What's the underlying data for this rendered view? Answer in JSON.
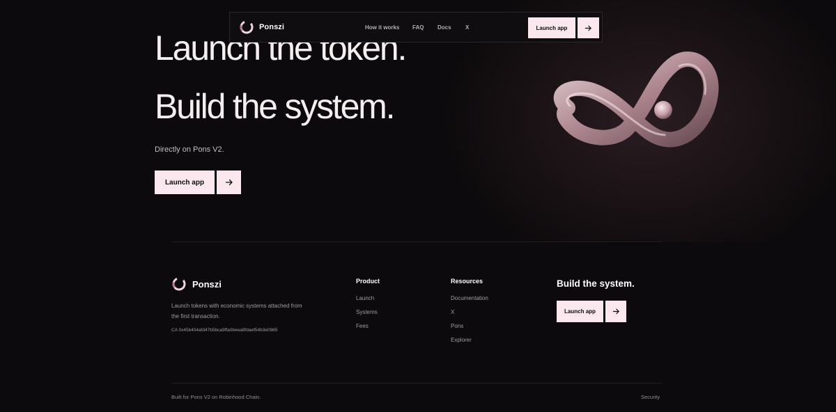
{
  "nav": {
    "brand": "Ponszi",
    "links": [
      "How it works",
      "FAQ",
      "Docs",
      "X"
    ],
    "launch_label": "Launch app"
  },
  "hero": {
    "line1": "Launch the token.",
    "line2": "Build the system.",
    "subtitle": "Directly on Pons V2.",
    "launch_label": "Launch app"
  },
  "footer": {
    "brand": "Ponszi",
    "description": "Launch tokens with economic systems attached from the first transaction.",
    "contract": "CA 0x45b404afd47b5bca9ffa0beea9fdaef54b3e0985",
    "product": {
      "heading": "Product",
      "links": [
        "Launch",
        "Systems",
        "Fees"
      ]
    },
    "resources": {
      "heading": "Resources",
      "links": [
        "Documentation",
        "X",
        "Pons",
        "Explorer"
      ]
    },
    "cta": {
      "title": "Build the system.",
      "launch_label": "Launch app"
    },
    "bottom": {
      "left": "Built for Pons V2 on Robinhood Chain.",
      "right": "Security"
    }
  },
  "icons": {
    "logo": "ponszi-ring-logo",
    "arrow": "arrow-right-icon",
    "hero_art": "glass-infinity-knot"
  },
  "colors": {
    "background": "#0c0a0c",
    "button": "#fbe8ee",
    "button_text": "#0e0b0d",
    "muted_text": "#a49ca0",
    "logo_pink": "#e3a8b8"
  }
}
